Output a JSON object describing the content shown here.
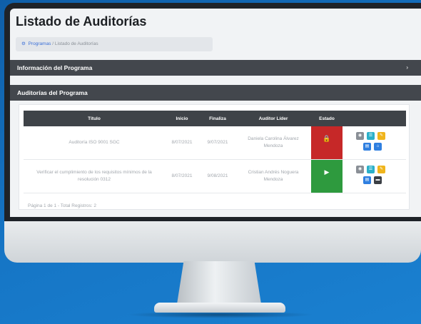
{
  "page": {
    "title": "Listado de Auditorías"
  },
  "breadcrumb": {
    "home_label": "Programas",
    "separator": "/",
    "current": "Listado de Auditorías"
  },
  "sections": {
    "program_info": "Información del Programa",
    "program_audits": "Auditorías del Programa"
  },
  "table": {
    "columns": [
      "Título",
      "Inicio",
      "Finaliza",
      "Auditor Líder",
      "Estado",
      ""
    ],
    "rows": [
      {
        "title": "Auditoría ISO 9001 SGC",
        "start": "8/07/2021",
        "end": "9/07/2021",
        "lead_auditor": "Daniela Carolina Álvarez Mendoza",
        "status_icon": "lock-icon",
        "status_color": "#c62828"
      },
      {
        "title": "Verificar el cumplimiento de los requisitos mínimos de la resolución 0312",
        "start": "8/07/2021",
        "end": "9/08/2021",
        "lead_auditor": "Cristian Andrés Noguera Mendoza",
        "status_icon": "play-icon",
        "status_color": "#2e9a3e"
      }
    ],
    "footer": "Página 1 de 1 - Total Registros: 2"
  },
  "colors": {
    "background_blue": "#1676c6",
    "header_bar": "#43474d",
    "locked_red": "#c62828",
    "active_green": "#2e9a3e",
    "action_teal": "#2bb0c9",
    "action_yellow": "#f0b51c",
    "action_blue": "#2f7fe0",
    "action_gray": "#8a8f96"
  }
}
